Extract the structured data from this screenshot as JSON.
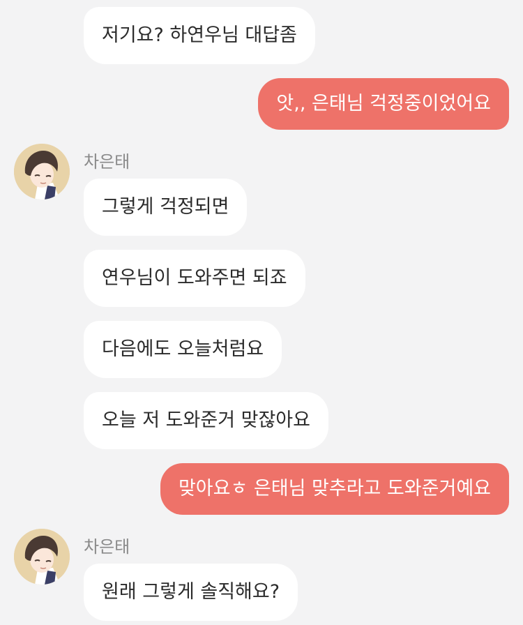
{
  "messages": [
    {
      "text": "저기요? 하연우님 대답좀"
    },
    {
      "text": "앗,, 은태님 걱정중이었어요"
    },
    {
      "text": "그렇게 걱정되면"
    },
    {
      "text": "연우님이 도와주면 되죠"
    },
    {
      "text": "다음에도 오늘처럼요"
    },
    {
      "text": "오늘 저 도와준거 맞잖아요"
    },
    {
      "text": "맞아요ㅎ 은태님 맞추라고 도와준거예요"
    },
    {
      "text": "원래 그렇게 솔직해요?"
    }
  ],
  "senders": [
    {
      "name": "차은태"
    },
    {
      "name": "차은태"
    }
  ],
  "colors": {
    "background": "#f3f3f4",
    "incoming_bubble": "#ffffff",
    "outgoing_bubble": "#ee7269",
    "sender_name": "#8a8a8a"
  }
}
